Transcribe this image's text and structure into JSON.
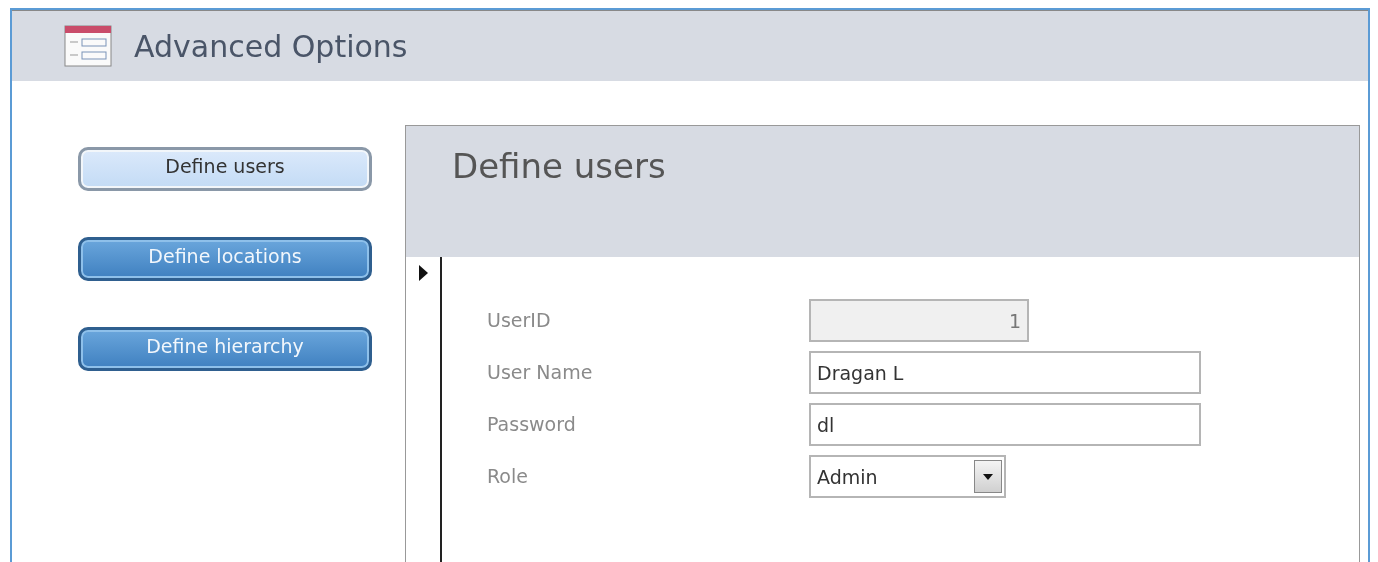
{
  "window": {
    "title": "Advanced Options"
  },
  "nav_buttons": [
    {
      "label": "Define users",
      "selected": true
    },
    {
      "label": "Define locations",
      "selected": false
    },
    {
      "label": "Define hierarchy",
      "selected": false
    }
  ],
  "subform": {
    "title": "Define users",
    "fields": [
      {
        "label": "UserID",
        "kind": "text",
        "value": "1",
        "disabled": true
      },
      {
        "label": "User Name",
        "kind": "text",
        "value": "Dragan L",
        "disabled": false
      },
      {
        "label": "Password",
        "kind": "text",
        "value": "dl",
        "disabled": false
      },
      {
        "label": "Role",
        "kind": "combo",
        "value": "Admin",
        "disabled": false
      }
    ]
  }
}
